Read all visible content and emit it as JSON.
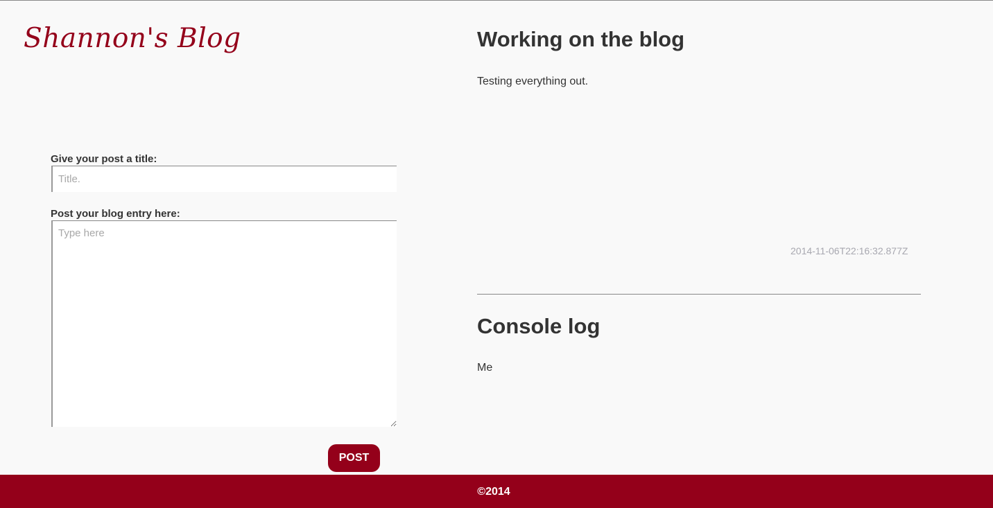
{
  "header": {
    "logo_text": "Shannon's Blog"
  },
  "form": {
    "title_label": "Give your post a title:",
    "title_placeholder": "Title.",
    "title_value": "",
    "body_label": "Post your blog entry here:",
    "body_placeholder": "Type here",
    "body_value": "",
    "post_button_label": "POST"
  },
  "post": {
    "title": "Working on the blog",
    "body": "Testing everything out.",
    "timestamp": "2014-11-06T22:16:32.877Z"
  },
  "console": {
    "heading": "Console log",
    "entries": [
      "Me"
    ]
  },
  "footer": {
    "copyright": "©2014"
  },
  "colors": {
    "brand": "#94001a",
    "background": "#f9f9f9",
    "text": "#333333"
  }
}
